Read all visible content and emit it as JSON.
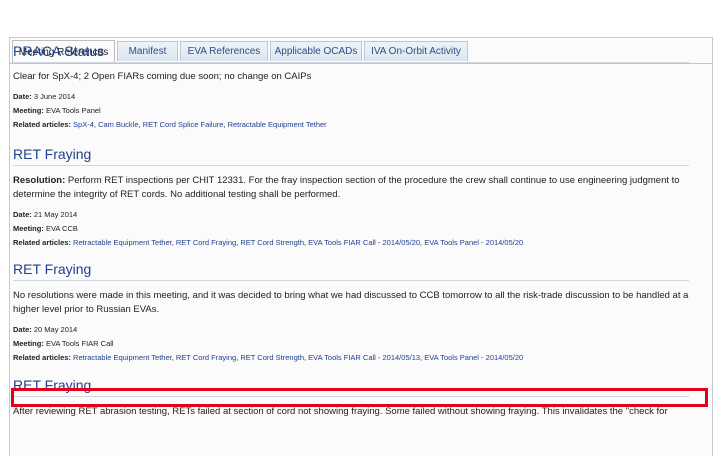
{
  "tabs": [
    {
      "label": "Meeting References",
      "active": true
    },
    {
      "label": "Manifest",
      "active": false
    },
    {
      "label": "EVA References",
      "active": false
    },
    {
      "label": "Applicable OCADs",
      "active": false
    },
    {
      "label": "IVA On-Orbit Activity",
      "active": false
    }
  ],
  "sections": [
    {
      "title": "PRACA Status",
      "desc_bold": "",
      "desc_text": "Clear for SpX-4; 2 Open FIARs coming due soon; no change on CAIPs",
      "date_label": "Date:",
      "date": "3 June 2014",
      "meeting_label": "Meeting:",
      "meeting": "EVA Tools Panel",
      "related_label": "Related articles:",
      "articles": [
        "SpX-4",
        "Cam Buckle",
        "RET Cord Splice Failure",
        "Retractable Equipment Tether"
      ]
    },
    {
      "title": "RET Fraying",
      "desc_bold": "Resolution:",
      "desc_text": " Perform RET inspections per CHIT 12331. For the fray inspection section of the procedure the crew shall continue to use engineering judgment to determine the integrity of RET cords. No additional testing shall be performed.",
      "date_label": "Date:",
      "date": "21 May 2014",
      "meeting_label": "Meeting:",
      "meeting": "EVA CCB",
      "related_label": "Related articles:",
      "articles": [
        "Retractable Equipment Tether",
        "RET Cord Fraying",
        "RET Cord Strength",
        "EVA Tools FIAR Call - 2014/05/20",
        "EVA Tools Panel - 2014/05/20"
      ]
    },
    {
      "title": "RET Fraying",
      "desc_bold": "",
      "desc_text": "No resolutions were made in this meeting, and it was decided to bring what we had discussed to CCB tomorrow to all the risk-trade discussion to be handled at a higher level prior to Russian EVAs.",
      "date_label": "Date:",
      "date": "20 May 2014",
      "meeting_label": "Meeting:",
      "meeting": "EVA Tools FIAR Call",
      "related_label": "Related articles:",
      "articles": [
        "Retractable Equipment Tether",
        "RET Cord Fraying",
        "RET Cord Strength",
        "EVA Tools FIAR Call - 2014/05/13",
        "EVA Tools Panel - 2014/05/20"
      ]
    },
    {
      "title": "RET Fraying",
      "desc_bold": "",
      "desc_text": "After reviewing RET abrasion testing, RETs failed at section of cord not showing fraying. Some failed without showing fraying. This invalidates the \"check for",
      "date_label": "",
      "date": "",
      "meeting_label": "",
      "meeting": "",
      "related_label": "",
      "articles": []
    }
  ],
  "highlight_color": "#e0001b"
}
